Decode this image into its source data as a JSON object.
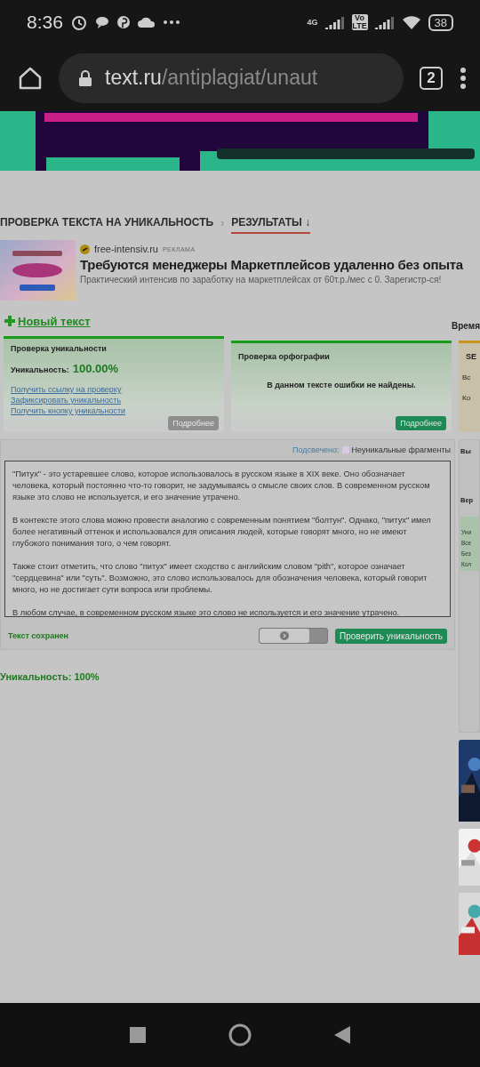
{
  "status_bar": {
    "time": "8:36",
    "network": "4G",
    "volte": "Vo LTE",
    "battery": "38"
  },
  "browser": {
    "url_host": "text.ru",
    "url_path": "/antiplagiat/unaut",
    "tab_count": "2"
  },
  "breadcrumb_separator": "›",
  "breadcrumbs": [
    {
      "label": "ПРОВЕРКА ТЕКСТА НА УНИКАЛЬНОСТЬ",
      "selected": false
    },
    {
      "label": "РЕЗУЛЬТАТЫ ↓",
      "selected": true
    }
  ],
  "ad": {
    "domain": "free-intensiv.ru",
    "tag": "РЕКЛАМА",
    "title": "Требуются менеджеры Маркетплейсов удаленно без опыта",
    "text": "Практический интенсив по заработку на маркетплейсах от 60т.р./мес с 0. Зарегистр-ся!"
  },
  "new_text_link": "Новый текст",
  "time_label": "Время",
  "cards": [
    {
      "kind": "uniqueness",
      "title": "Проверка уникальности",
      "label": "Уникальность:",
      "value": "100.00%",
      "links": [
        "Получить ссылку на проверку",
        "Зафиксировать уникальность",
        "Получить кнопку уникальности"
      ],
      "button": "Подробнее",
      "button_disabled": true
    },
    {
      "kind": "spelling",
      "title": "Проверка орфографии",
      "message": "В данном тексте ошибки не найдены.",
      "button": "Подробнее",
      "button_disabled": false
    },
    {
      "kind": "seo",
      "title": "SE",
      "lines": [
        "Вс",
        "Ко"
      ]
    }
  ],
  "legend": {
    "label": "Подсвечено:",
    "color": "#d9c8e6",
    "text": "Неуникальные фрагменты"
  },
  "editor_paragraphs": [
    "\"Питух\" - это устаревшее слово, которое использовалось в русском языке в XIX веке. Оно обозначает человека, который постоянно что-то говорит, не задумываясь о смысле своих слов. В современном русском языке это слово не используется, и его значение утрачено.",
    "В контексте этого слова можно провести аналогию с современным понятием \"болтун\". Однако, \"питух\" имел более негативный оттенок и использовался для описания людей, которые говорят много, но не имеют глубокого понимания того, о чем говорят.",
    "Также стоит отметить, что слово \"питух\" имеет сходство с английским словом \"pith\", которое означает \"сердцевина\" или \"суть\". Возможно, это слово использовалось для обозначения человека, который говорит много, но не достигает сути вопроса или проблемы.",
    "В любом случае, в современном русском языке это слово не используется и его значение утрачено."
  ],
  "saved_status": "Текст сохранен",
  "toggle": {
    "on": false
  },
  "check_button": "Проверить уникальность",
  "result": "Уникальность: 100%",
  "side": {
    "heading1": "Вы",
    "heading2": "Вер",
    "box_lines": [
      "Уни",
      "Все",
      "Без",
      "Кол"
    ]
  }
}
